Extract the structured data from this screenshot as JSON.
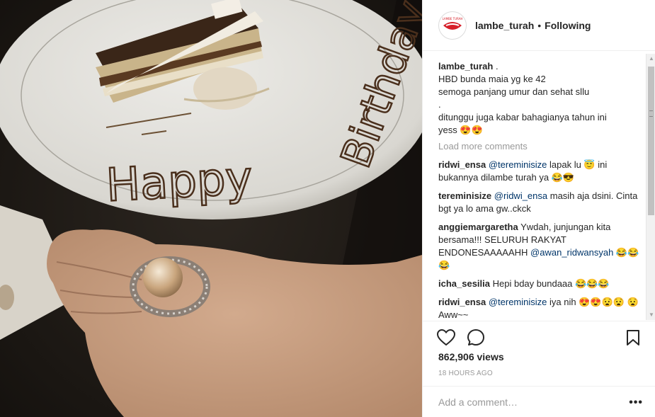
{
  "post": {
    "username": "lambe_turah",
    "separator": "•",
    "follow_status": "Following",
    "avatar_text": "LAMBE TURAH",
    "plate_writing_1": "Happy",
    "plate_writing_2": "Birthday!"
  },
  "caption": {
    "username": "lambe_turah",
    "lines": [
      ".",
      "HBD bunda maia yg ke 42",
      "semoga panjang umur dan sehat sllu",
      ".",
      "ditunggu juga kabar bahagianya tahun ini",
      "yess 😍😍"
    ]
  },
  "load_more": "Load more comments",
  "comments": [
    {
      "user": "ridwi_ensa",
      "mention": "@tereminisize",
      "text": " lapak lu 😇 ini bukannya dilambe turah ya 😂😎"
    },
    {
      "user": "tereminisize",
      "mention": "@ridwi_ensa",
      "text": " masih aja dsini. Cinta bgt ya lo ama gw..ckck"
    },
    {
      "user": "anggiemargaretha",
      "mention": "",
      "text": "Ywdah, junjungan kita bersama!!! SELURUH RAKYAT ENDONESAAAAAHH",
      "mention2": "@awan_ridwansyah",
      "text2": " 😂😂😂"
    },
    {
      "user": "icha_sesilia",
      "mention": "",
      "text": "Hepi bday bundaaa 😂😂😂"
    },
    {
      "user": "ridwi_ensa",
      "mention": "@tereminisize",
      "text": " iya nih 😍😍😧😧 😧 Aww~~"
    }
  ],
  "stats": {
    "views": "862,906 views",
    "time": "18 HOURS AGO"
  },
  "comment_box": {
    "placeholder": "Add a comment…",
    "more": "•••"
  },
  "icons": {
    "like": "heart-icon",
    "comment": "comment-bubble-icon",
    "save": "bookmark-icon",
    "more": "more-options-icon"
  },
  "colors": {
    "text": "#262626",
    "muted": "#999999",
    "mention": "#003569",
    "border": "#efefef",
    "logo_red": "#d6202a"
  }
}
